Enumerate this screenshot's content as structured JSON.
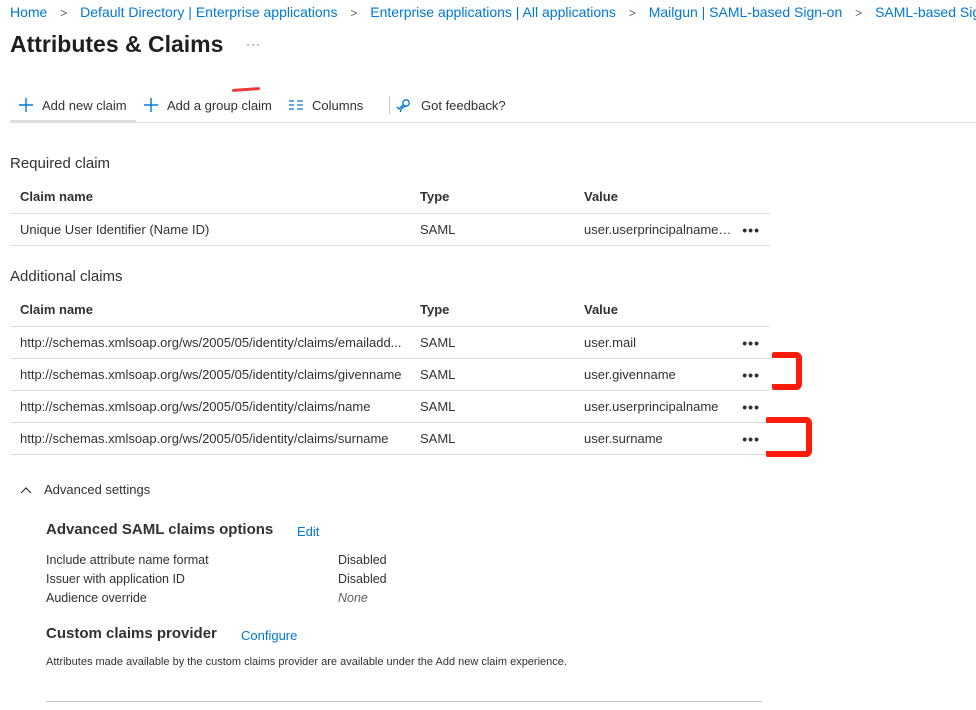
{
  "breadcrumb": {
    "items": [
      "Home",
      "Default Directory | Enterprise applications",
      "Enterprise applications | All applications",
      "Mailgun | SAML-based Sign-on",
      "SAML-based Sign-on"
    ]
  },
  "page": {
    "title": "Attributes & Claims",
    "more": "···"
  },
  "toolbar": {
    "add_new_claim": "Add new claim",
    "add_group_claim": "Add a group claim",
    "columns": "Columns",
    "feedback": "Got feedback?"
  },
  "required": {
    "title": "Required claim",
    "headers": {
      "name": "Claim name",
      "type": "Type",
      "value": "Value"
    },
    "rows": [
      {
        "name": "Unique User Identifier (Name ID)",
        "type": "SAML",
        "value": "user.userprincipalname [..."
      }
    ]
  },
  "additional": {
    "title": "Additional claims",
    "headers": {
      "name": "Claim name",
      "type": "Type",
      "value": "Value"
    },
    "rows": [
      {
        "name": "http://schemas.xmlsoap.org/ws/2005/05/identity/claims/emailadd...",
        "type": "SAML",
        "value": "user.mail"
      },
      {
        "name": "http://schemas.xmlsoap.org/ws/2005/05/identity/claims/givenname",
        "type": "SAML",
        "value": "user.givenname"
      },
      {
        "name": "http://schemas.xmlsoap.org/ws/2005/05/identity/claims/name",
        "type": "SAML",
        "value": "user.userprincipalname"
      },
      {
        "name": "http://schemas.xmlsoap.org/ws/2005/05/identity/claims/surname",
        "type": "SAML",
        "value": "user.surname"
      }
    ]
  },
  "row_more": "•••",
  "advanced": {
    "toggle_label": "Advanced settings",
    "saml_options": {
      "title": "Advanced SAML claims options",
      "edit": "Edit",
      "items": [
        {
          "label": "Include attribute name format",
          "value": "Disabled"
        },
        {
          "label": "Issuer with application ID",
          "value": "Disabled"
        },
        {
          "label": "Audience override",
          "value": "None"
        }
      ]
    },
    "custom_provider": {
      "title": "Custom claims provider",
      "configure": "Configure",
      "note": "Attributes made available by the custom claims provider are available under the Add new claim experience."
    }
  },
  "colors": {
    "accent": "#0078d4",
    "annotation": "#ff1a0a"
  },
  "icons": {
    "breadcrumb_separator": "chevron-right-icon",
    "add": "plus-icon",
    "columns": "columns-icon",
    "feedback": "feedback-icon",
    "more": "ellipsis-icon",
    "advanced_toggle": "chevron-up-icon"
  }
}
